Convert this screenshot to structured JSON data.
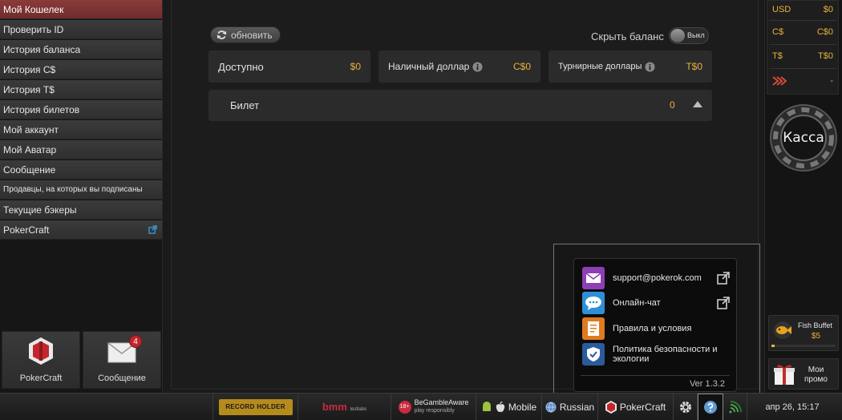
{
  "sidebar": {
    "items": [
      {
        "label": "Мой Кошелек",
        "active": true
      },
      {
        "label": "Проверить ID"
      },
      {
        "label": "История баланса"
      },
      {
        "label": "История C$"
      },
      {
        "label": "История T$"
      },
      {
        "label": "История билетов"
      },
      {
        "label": "Мой аккаунт"
      },
      {
        "label": "Мой Аватар"
      },
      {
        "label": "Сообщение"
      },
      {
        "label": "Продавцы, на которых вы подписаны"
      },
      {
        "label": "Текущие бэкеры"
      },
      {
        "label": "PokerCraft",
        "external": true
      }
    ],
    "tiles": {
      "pokercraft_label": "PokerCraft",
      "message_label": "Сообщение",
      "message_badge": "4"
    }
  },
  "main": {
    "refresh_label": "обновить",
    "hide_balance_label": "Скрыть баланс",
    "toggle_label": "Выкл",
    "balances": {
      "available_label": "Доступно",
      "available_value": "$0",
      "cash_label": "Наличный доллар",
      "cash_value": "C$0",
      "tournament_label": "Турнирные доллары",
      "tournament_value": "T$0"
    },
    "ticket_label": "Билет",
    "ticket_value": "0"
  },
  "help_popup": {
    "items": [
      {
        "label": "support@pokerok.com",
        "icon": "mail-icon",
        "color": "#8e3fb5"
      },
      {
        "label": "Онлайн-чат",
        "icon": "chat-icon",
        "color": "#2f8fd6"
      },
      {
        "label": "Правила и условия",
        "icon": "document-icon",
        "color": "#e07a1e"
      },
      {
        "label": "Политика безопасности и экологии",
        "icon": "shield-icon",
        "color": "#2c5b9c"
      }
    ],
    "version": "Ver 1.3.2"
  },
  "right_panel": {
    "currencies": [
      {
        "code": "USD",
        "value": "$0"
      },
      {
        "code": "C$",
        "value": "C$0"
      },
      {
        "code": "T$",
        "value": "T$0"
      },
      {
        "code": "",
        "value": "-"
      }
    ],
    "cashier_label": "Касса",
    "fish_buffet_title": "Fish Buffet",
    "fish_buffet_value": "$5",
    "fish_buffet_progress": 0.05,
    "promo_line1": "Мои",
    "promo_line2": "промо"
  },
  "bottom_bar": {
    "record_holder": "RECORD HOLDER",
    "bmm": "bmm",
    "bmm_small": "testlabs",
    "begamble": "BeGambleAware",
    "begamble_small": "play responsibly",
    "age": "18+",
    "mobile": "Mobile",
    "language": "Russian",
    "pokercraft": "PokerCraft",
    "datetime": "апр 26, 15:17"
  },
  "colors": {
    "accent_gold": "#e8b23a",
    "active_item": "#8a3a3a"
  }
}
